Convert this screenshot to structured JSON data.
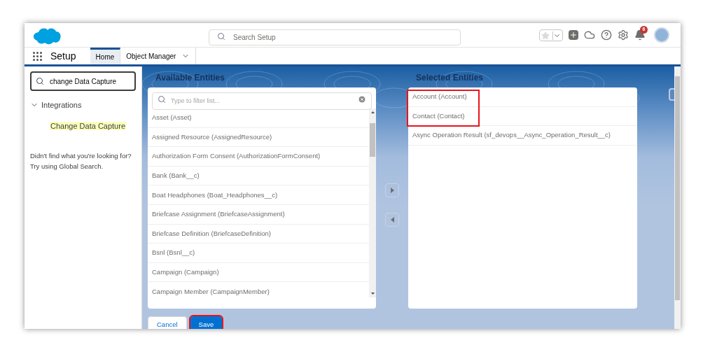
{
  "header": {
    "search": {
      "placeholder": "Search Setup"
    },
    "notifications": {
      "count": "6"
    }
  },
  "nav": {
    "app_name": "Setup",
    "tabs": [
      {
        "label": "Home",
        "selected": true,
        "dropdown": false
      },
      {
        "label": "Object Manager",
        "selected": false,
        "dropdown": true
      }
    ]
  },
  "sidebar": {
    "search": {
      "value": "change Data Capture"
    },
    "tree": [
      {
        "label": "Integrations",
        "expanded": true,
        "children": [
          {
            "label": "Change Data Capture",
            "highlighted": true
          }
        ]
      }
    ],
    "help_lines": [
      "Didn't find what you're looking for?",
      "Try using Global Search."
    ]
  },
  "available": {
    "title": "Available Entities",
    "filter": {
      "placeholder": "Type to filter list..."
    },
    "items": [
      {
        "label": "Asset (Asset)"
      },
      {
        "label": "Assigned Resource (AssignedResource)"
      },
      {
        "label": "Authorization Form Consent (AuthorizationFormConsent)"
      },
      {
        "label": "Bank (Bank__c)"
      },
      {
        "label": "Boat Headphones (Boat_Headphones__c)"
      },
      {
        "label": "Briefcase Assignment (BriefcaseAssignment)"
      },
      {
        "label": "Briefcase Definition (BriefcaseDefinition)"
      },
      {
        "label": "Bsnl (Bsnl__c)"
      },
      {
        "label": "Campaign (Campaign)"
      },
      {
        "label": "Campaign Member (CampaignMember)"
      }
    ]
  },
  "selected": {
    "title": "Selected Entities",
    "items": [
      {
        "label": "Account (Account)",
        "highlighted": true
      },
      {
        "label": "Contact (Contact)",
        "highlighted": true
      },
      {
        "label": "Async Operation Result (sf_devops__Async_Operation_Result__c)",
        "highlighted": false
      }
    ]
  },
  "buttons": [
    {
      "label": "Cancel",
      "kind": "neutral",
      "highlighted": false
    },
    {
      "label": "Save",
      "kind": "brand",
      "highlighted": true
    }
  ]
}
